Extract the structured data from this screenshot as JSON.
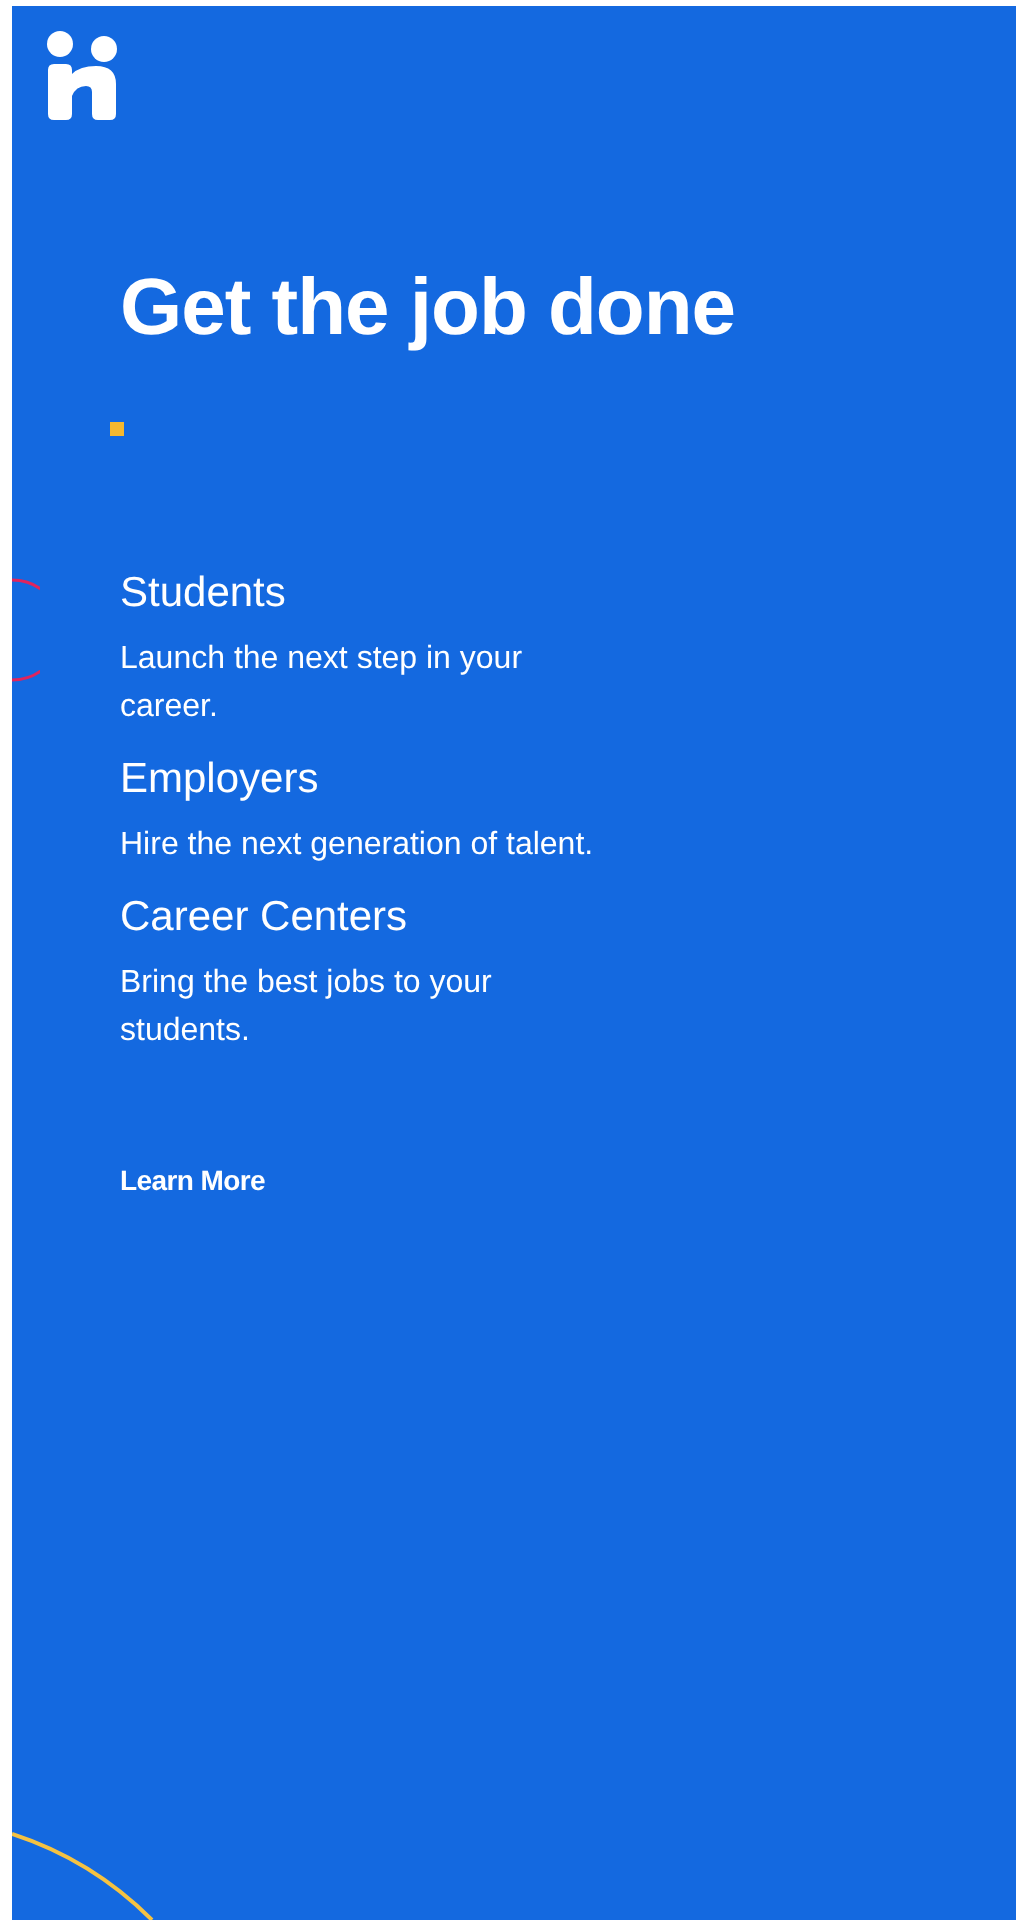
{
  "headline": "Get the job done",
  "audiences": [
    {
      "title": "Students",
      "description": "Launch the next step in your career."
    },
    {
      "title": "Employers",
      "description": "Hire the next generation of talent."
    },
    {
      "title": "Career Centers",
      "description": "Bring the best jobs to your students."
    }
  ],
  "link": "Learn More"
}
